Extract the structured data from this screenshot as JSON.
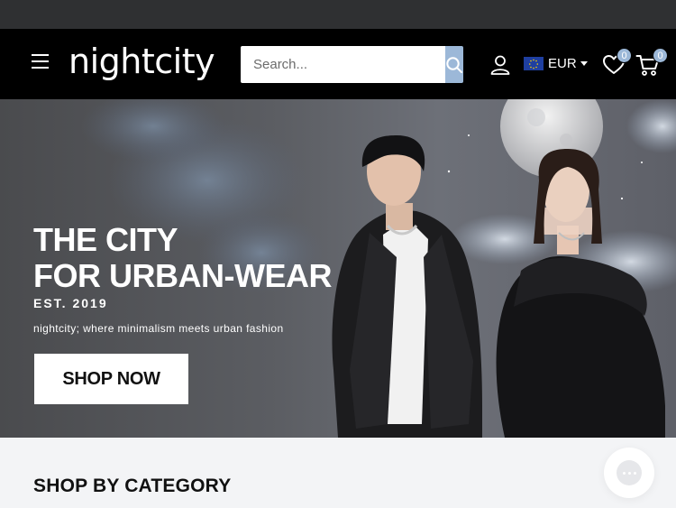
{
  "header": {
    "logo": "nightcity",
    "search": {
      "placeholder": "Search..."
    },
    "currency": "EUR",
    "wishlist_count": "0",
    "cart_count": "0"
  },
  "hero": {
    "title_line1": "THE CITY",
    "title_line2": "FOR URBAN-WEAR",
    "est": "EST. 2019",
    "subtitle": "nightcity; where minimalism meets urban fashion",
    "cta": "SHOP NOW"
  },
  "sections": {
    "category_title": "SHOP BY CATEGORY"
  },
  "icons": [
    "menu-icon",
    "search-icon",
    "account-icon",
    "eu-flag-icon",
    "chevron-down-icon",
    "heart-icon",
    "cart-icon",
    "chat-icon"
  ],
  "colors": {
    "header_bg": "#000000",
    "accent": "#9cb8d8",
    "announcement_bg": "#2f3032",
    "page_bg": "#f3f4f6"
  }
}
